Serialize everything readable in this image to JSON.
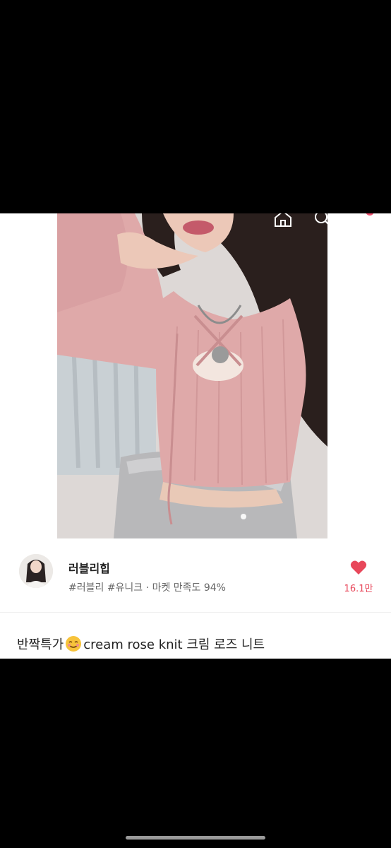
{
  "seller": {
    "name": "러블리힙",
    "tags": "#러블리 #유니크",
    "separator": "·",
    "satisfaction": "마켓 만족도 94%",
    "likes": "16.1만"
  },
  "product": {
    "title_prefix": "반짝특가",
    "title_suffix": "cream rose knit 크림 로즈 니트"
  },
  "icons": {
    "back": "back-arrow-icon",
    "home": "home-icon",
    "search": "search-icon",
    "cart": "cart-icon",
    "heart": "heart-icon",
    "emoji": "smiling-face-emoji"
  },
  "colors": {
    "accent": "#e8475a",
    "cart_badge": "#f0506e"
  }
}
